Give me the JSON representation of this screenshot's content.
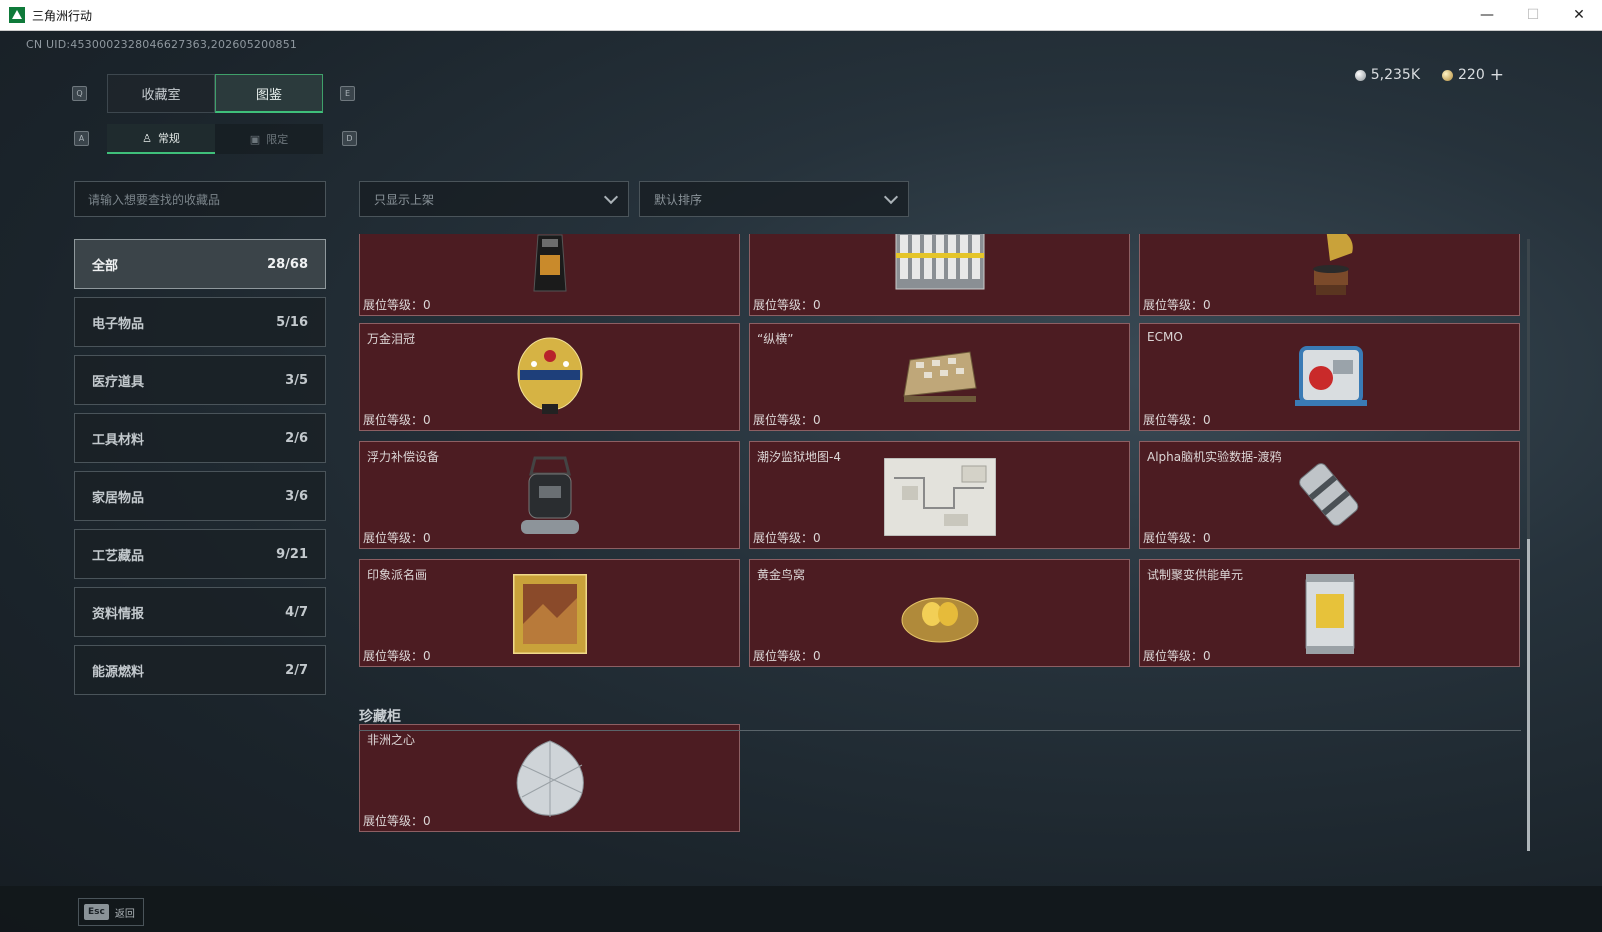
{
  "window": {
    "title": "三角洲行动",
    "minimize": "—",
    "maximize": "☐",
    "close": "✕"
  },
  "header": {
    "uid": "CN UID:4530002328046627363,202605200851"
  },
  "currency": {
    "silver": "5,235K",
    "gold": "220",
    "add": "+"
  },
  "keys": {
    "q": "Q",
    "e": "E",
    "a": "A",
    "d": "D"
  },
  "tabs": [
    {
      "label": "收藏室"
    },
    {
      "label": "图鉴"
    }
  ],
  "subtabs": [
    {
      "label": "常规",
      "icon": "person-icon"
    },
    {
      "label": "限定",
      "icon": "image-icon"
    }
  ],
  "search": {
    "placeholder": "请输入想要查找的收藏品"
  },
  "filters": {
    "shelf": "只显示上架",
    "sort": "默认排序"
  },
  "categories": [
    {
      "label": "全部",
      "count": "28/68"
    },
    {
      "label": "电子物品",
      "count": "5/16"
    },
    {
      "label": "医疗道具",
      "count": "3/5"
    },
    {
      "label": "工具材料",
      "count": "2/6"
    },
    {
      "label": "家居物品",
      "count": "3/6"
    },
    {
      "label": "工艺藏品",
      "count": "9/21"
    },
    {
      "label": "资料情报",
      "count": "4/7"
    },
    {
      "label": "能源燃料",
      "count": "2/7"
    }
  ],
  "level_label": "展位等级：0",
  "items": [
    {
      "name": "",
      "icon": "coffee-bag-icon"
    },
    {
      "name": "",
      "icon": "battery-pack-icon"
    },
    {
      "name": "",
      "icon": "gramophone-icon"
    },
    {
      "name": "万金泪冠",
      "icon": "jeweled-egg-icon"
    },
    {
      "name": "“纵横”",
      "icon": "chess-board-icon"
    },
    {
      "name": "ECMO",
      "icon": "ecmo-machine-icon"
    },
    {
      "name": "浮力补偿设备",
      "icon": "buoyancy-device-icon"
    },
    {
      "name": "潮汐监狱地图-4",
      "icon": "map-icon"
    },
    {
      "name": "Alpha脑机实验数据-渡鸦",
      "icon": "data-canister-icon"
    },
    {
      "name": "印象派名画",
      "icon": "painting-icon"
    },
    {
      "name": "黄金鸟窝",
      "icon": "golden-nest-icon"
    },
    {
      "name": "试制聚变供能单元",
      "icon": "fusion-unit-icon"
    }
  ],
  "cabinet": {
    "title": "珍藏柜",
    "items": [
      {
        "name": "非洲之心",
        "icon": "diamond-icon"
      }
    ]
  },
  "footer": {
    "esc_key": "Esc",
    "esc_label": "返回"
  },
  "colors": {
    "accent": "#3fbf7a",
    "card_bg": "#4c1c22",
    "card_border": "#8d5f63"
  }
}
